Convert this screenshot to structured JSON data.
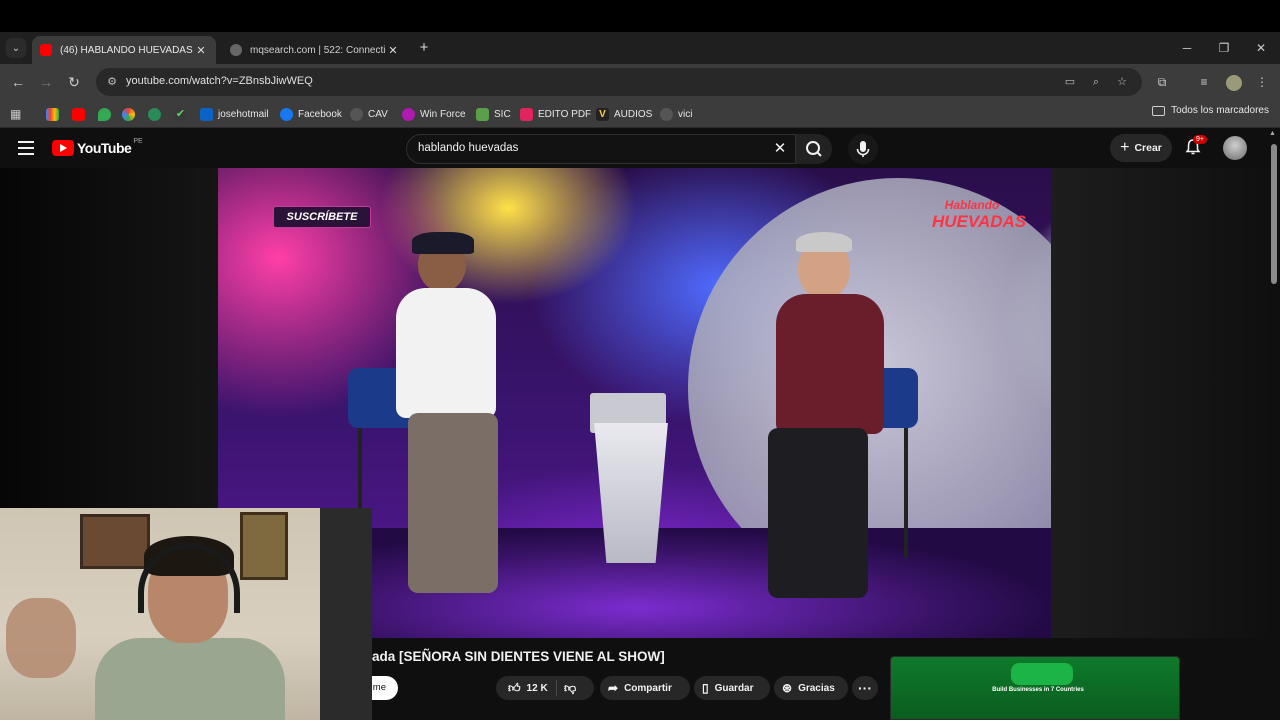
{
  "browser": {
    "tabs": [
      {
        "title": "(46) HABLANDO HUEVADAS - ",
        "active": true,
        "favicon": "youtube-icon"
      },
      {
        "title": "mqsearch.com | 522: Connectio",
        "active": false,
        "favicon": "globe-icon"
      }
    ],
    "url": "youtube.com/watch?v=ZBnsbJiwWEQ",
    "bookmarks": [
      {
        "label": "",
        "icon": "colorful-square-icon"
      },
      {
        "label": "",
        "icon": "youtube-icon"
      },
      {
        "label": "",
        "icon": "maps-icon"
      },
      {
        "label": "",
        "icon": "photos-icon"
      },
      {
        "label": "",
        "icon": "globe-icon"
      },
      {
        "label": "",
        "icon": "check-icon"
      },
      {
        "label": "josehotmail",
        "icon": "outlook-icon"
      },
      {
        "label": "Facebook",
        "icon": "facebook-icon"
      },
      {
        "label": "CAV",
        "icon": "globe-icon"
      },
      {
        "label": "Win Force",
        "icon": "winforce-icon"
      },
      {
        "label": "SIC",
        "icon": "sic-icon"
      },
      {
        "label": "EDITO PDF",
        "icon": "pdf-icon"
      },
      {
        "label": "AUDIOS",
        "icon": "v-icon"
      },
      {
        "label": "vici",
        "icon": "globe-icon"
      }
    ],
    "all_bookmarks_label": "Todos los marcadores"
  },
  "youtube": {
    "logo_text": "YouTube",
    "country_code": "PE",
    "search_query": "hablando huevadas",
    "create_label": "Crear",
    "notification_badge": "9+"
  },
  "video": {
    "overlay_subscribe": "SUSCRÍBETE",
    "overlay_logo_line1": "Hablando",
    "overlay_logo_line2": "HUEVADAS",
    "title": "ada [SEÑORA SIN DIENTES VIENE AL SHOW]",
    "join_label": "me",
    "likes": "12 K",
    "share_label": "Compartir",
    "save_label": "Guardar",
    "thanks_label": "Gracias"
  },
  "ad": {
    "text": "Build Businesses in 7 Countries"
  },
  "colors": {
    "accent_red": "#ff0000",
    "ad_green": "#0e7a2b"
  }
}
